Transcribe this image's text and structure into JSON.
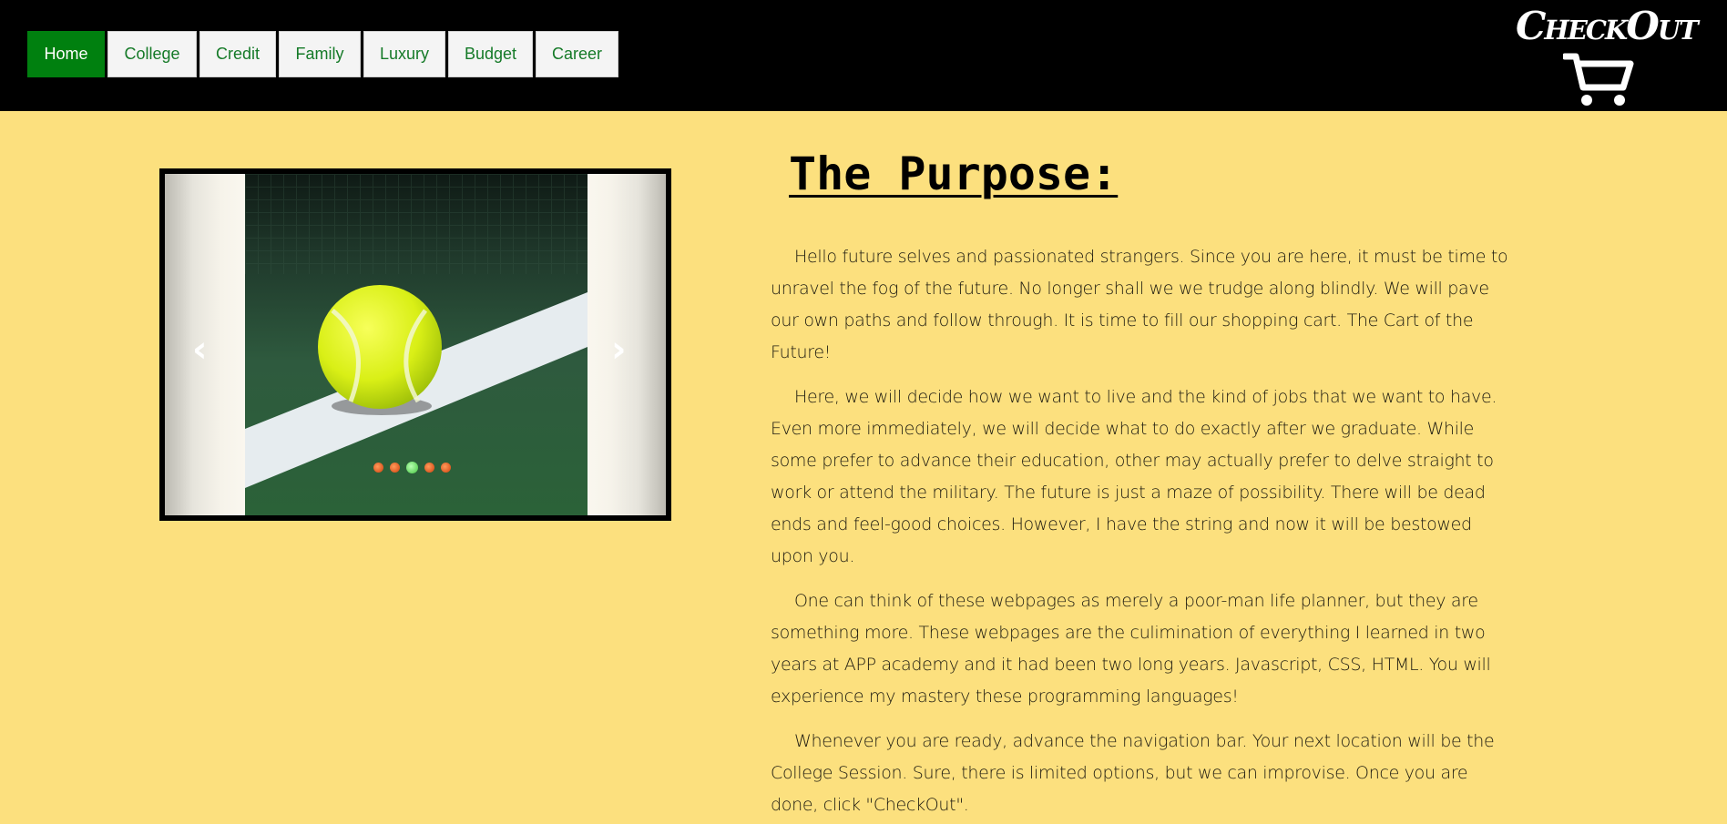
{
  "nav": {
    "items": [
      {
        "label": "Home",
        "active": true
      },
      {
        "label": "College",
        "active": false
      },
      {
        "label": "Credit",
        "active": false
      },
      {
        "label": "Family",
        "active": false
      },
      {
        "label": "Luxury",
        "active": false
      },
      {
        "label": "Budget",
        "active": false
      },
      {
        "label": "Career",
        "active": false
      }
    ]
  },
  "checkout": {
    "label": "CheckOut",
    "icon": "shopping-cart-icon"
  },
  "slider": {
    "prev_icon": "chevron-left-icon",
    "next_icon": "chevron-right-icon",
    "slide_count": 5,
    "active_index": 2,
    "image": "tennis-ball-photo"
  },
  "content": {
    "title": "The Purpose:",
    "paragraphs": [
      "Hello future selves and passionated strangers. Since you are here, it must be time to unravel the fog of the future. No longer shall we we trudge along blindly. We will pave our own paths and follow through. It is time to fill our shopping cart. The Cart of the Future!",
      "Here, we will decide how we want to live and the kind of jobs that we want to have. Even more immediately, we will decide what to do exactly after we graduate. While some prefer to advance their education, other may actually prefer to delve straight to work or attend the military. The future is just a maze of possibility. There will be dead ends and feel-good choices. However, I have the string and now it will be bestowed upon you.",
      "One can think of these webpages as merely a poor-man life planner, but they are something more. These webpages are the culimination of everything I learned in two years at APP academy and it had been two long years. Javascript, CSS, HTML. You will experience my mastery these programming languages!",
      "Whenever you are ready, advance the navigation bar. Your next location will be the College Session. Sure, there is limited options, but we can improvise. Once you are done, click \"CheckOut\"."
    ]
  },
  "colors": {
    "background": "#fce07e",
    "topbar": "#000000",
    "nav_active": "#00800f",
    "nav_text": "#157a28"
  }
}
